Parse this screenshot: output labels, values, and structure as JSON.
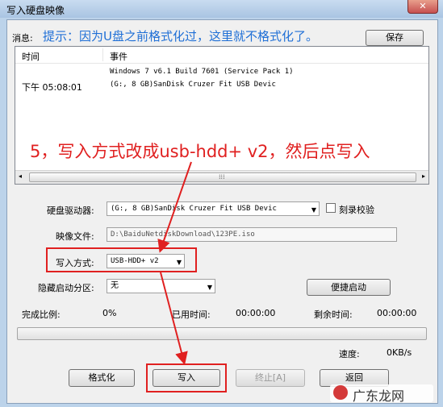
{
  "window": {
    "title": "写入硬盘映像",
    "close_glyph": "✕"
  },
  "message": {
    "label": "消息:",
    "text": "提示：因为U盘之前格式化过，这里就不格式化了。",
    "save_button": "保存"
  },
  "log": {
    "columns": [
      "时间",
      "事件"
    ],
    "rows": [
      {
        "time": "",
        "event": "Windows 7 v6.1 Build 7601 (Service Pack 1)"
      },
      {
        "time": "下午 05:08:01",
        "event": "(G:, 8 GB)SanDisk Cruzer Fit USB Devic"
      }
    ]
  },
  "annotation": {
    "text": "5，写入方式改成usb-hdd+ v2，然后点写入",
    "color": "#e02020"
  },
  "form": {
    "drive_label": "硬盘驱动器:",
    "drive_value": "(G:, 8 GB)SanDisk Cruzer Fit USB Devic",
    "verify_label": "刻录校验",
    "verify_checked": false,
    "image_label": "映像文件:",
    "image_value": "D:\\BaiduNetdiskDownload\\123PE.iso",
    "write_mode_label": "写入方式:",
    "write_mode_value": "USB-HDD+ v2",
    "hidden_part_label": "隐藏启动分区:",
    "hidden_part_value": "无",
    "quick_boot_button": "便捷启动"
  },
  "status": {
    "progress_label": "完成比例:",
    "progress_value": "0%",
    "progress_fraction": 0,
    "elapsed_label": "已用时间:",
    "elapsed_value": "00:00:00",
    "remaining_label": "剩余时间:",
    "remaining_value": "00:00:00",
    "speed_label": "速度:",
    "speed_value": "0KB/s"
  },
  "buttons": {
    "format": "格式化",
    "write": "写入",
    "abort": "终止[A]",
    "back": "返回"
  },
  "watermark": {
    "text": "广东龙网"
  }
}
